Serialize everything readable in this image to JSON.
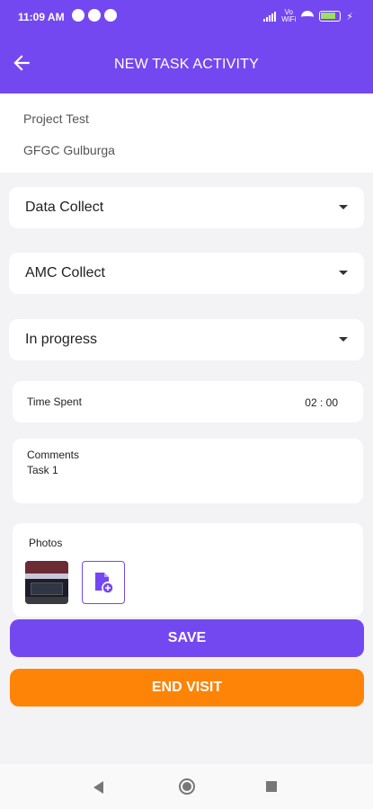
{
  "status_bar": {
    "time": "11:09 AM",
    "network_label": "Vo\nWiFi"
  },
  "app_bar": {
    "title": "NEW TASK ACTIVITY",
    "back_icon": "arrow-left-icon"
  },
  "project": {
    "name": "Project Test",
    "location": "GFGC Gulburga"
  },
  "dropdowns": [
    {
      "value": "Data Collect"
    },
    {
      "value": "AMC Collect"
    },
    {
      "value": "In progress"
    }
  ],
  "time_spent": {
    "label": "Time Spent",
    "value": "02 : 00"
  },
  "comments": {
    "label": "Comments",
    "value": "Task 1"
  },
  "photos": {
    "label": "Photos",
    "add_icon": "add-file-icon"
  },
  "buttons": {
    "save": "SAVE",
    "end_visit": "END VISIT"
  },
  "colors": {
    "primary": "#7448f0",
    "accent": "#fe8407",
    "background": "#f3f3f5"
  }
}
